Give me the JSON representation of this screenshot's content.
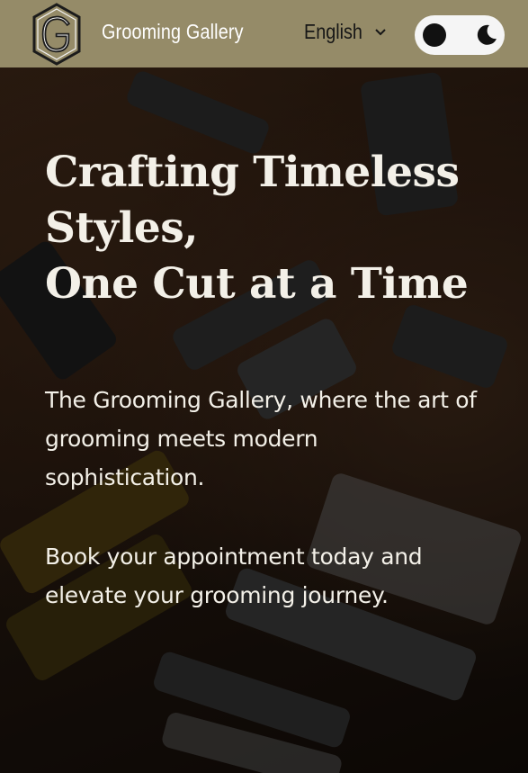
{
  "header": {
    "brand_name": "Grooming Gallery",
    "logo_letter": "G",
    "language": {
      "selected": "English"
    },
    "theme_toggle": {
      "icons": [
        "circle-icon",
        "moon-icon"
      ]
    }
  },
  "hero": {
    "title": "Crafting Timeless\nStyles,\nOne Cut at a Time",
    "paragraph_1": "The Grooming Gallery, where the art of grooming meets modern sophistication.",
    "paragraph_2": "Book your appointment today and elevate your grooming journey."
  },
  "colors": {
    "header_bg": "#958b68",
    "header_text": "#ffffff",
    "language_text": "#161616",
    "toggle_bg": "#f5f5f5",
    "hero_text": "#f3f0e8"
  }
}
